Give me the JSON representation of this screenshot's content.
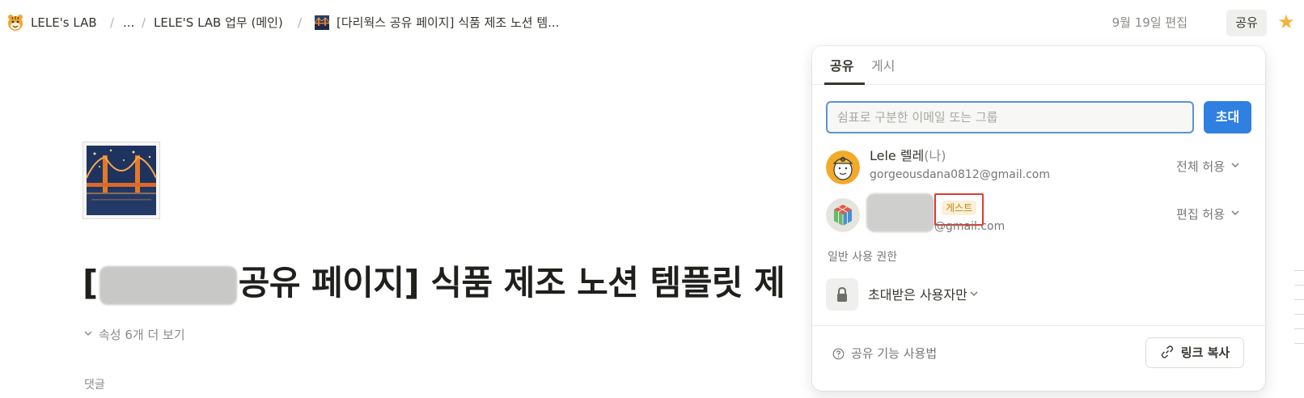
{
  "breadcrumb": {
    "items": [
      {
        "label": "LELE's LAB",
        "icon": "tiger-face-icon"
      },
      {
        "label": "..."
      },
      {
        "label": "LELE'S LAB 업무 (메인)"
      },
      {
        "label": "[다리웍스 공유 페이지] 식품 제조 노션 템...",
        "icon": "bridge-night-icon"
      }
    ],
    "separator": "/"
  },
  "header": {
    "edited": "9월 19일 편집",
    "share_label": "공유",
    "favorite_icon": "star-icon"
  },
  "page": {
    "icon": "bridge-at-night-emoji",
    "title_open": "[",
    "title_rest": "공유 페이지] 식품 제조 노션 템플릿 제",
    "properties_toggle": "속성 6개 더 보기",
    "comments_label": "댓글"
  },
  "share_popup": {
    "tabs": [
      {
        "label": "공유",
        "active": true
      },
      {
        "label": "게시",
        "active": false
      }
    ],
    "email_input": {
      "value": "",
      "placeholder": "쉼표로 구분한 이메일 또는 그룹"
    },
    "invite_label": "초대",
    "members": [
      {
        "name": "Lele 렐레",
        "you_suffix": "(나)",
        "email": "gorgeousdana0812@gmail.com",
        "permission": "전체 허용"
      },
      {
        "name": "",
        "badge": "게스트",
        "email": "@gmail.com",
        "permission": "편집 허용"
      }
    ],
    "general_access_label": "일반 사용 권한",
    "general_access_value": "초대받은 사용자만",
    "help_label": "공유 기능 사용법",
    "copy_link_label": "링크 복사"
  },
  "colors": {
    "accent_blue": "#2f80e0",
    "input_border": "#5a94d6",
    "guest_badge_text": "#c5850d",
    "guest_badge_bg": "#fbf0d9",
    "highlight_red": "#e03b2f",
    "star": "#f2b33a"
  }
}
